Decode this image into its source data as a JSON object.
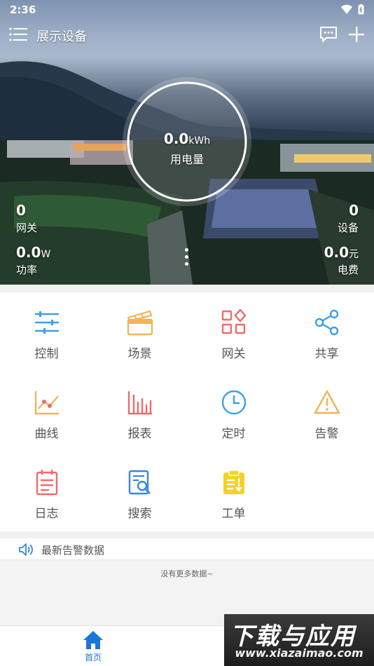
{
  "status_bar": {
    "time": "2:36"
  },
  "header": {
    "title": "展示设备"
  },
  "gauge": {
    "value": "0.0",
    "unit": "kWh",
    "label": "用电量"
  },
  "stats": {
    "gateway": {
      "value": "0",
      "label": "网关"
    },
    "device": {
      "value": "0",
      "label": "设备"
    },
    "power": {
      "value": "0.0",
      "unit": "W",
      "label": "功率"
    },
    "cost": {
      "value": "0.0",
      "unit": "元",
      "label": "电费"
    }
  },
  "menu_grid": {
    "items": [
      {
        "label": "控制",
        "icon": "sliders-icon",
        "color": "#3aa0e8"
      },
      {
        "label": "场景",
        "icon": "clapperboard-icon",
        "color": "#f0b45a"
      },
      {
        "label": "网关",
        "icon": "gateway-grid-icon",
        "color": "#ef6b6b"
      },
      {
        "label": "共享",
        "icon": "share-icon",
        "color": "#3aa0e8"
      },
      {
        "label": "曲线",
        "icon": "line-chart-icon",
        "color": "#f0b45a"
      },
      {
        "label": "报表",
        "icon": "bar-chart-icon",
        "color": "#ef6b6b"
      },
      {
        "label": "定时",
        "icon": "clock-icon",
        "color": "#3aa0e8"
      },
      {
        "label": "告警",
        "icon": "warning-icon",
        "color": "#f0b45a"
      },
      {
        "label": "日志",
        "icon": "calendar-log-icon",
        "color": "#ef6b6b"
      },
      {
        "label": "搜索",
        "icon": "document-search-icon",
        "color": "#3a86d8"
      },
      {
        "label": "工单",
        "icon": "work-order-icon",
        "color": "#f2d325"
      }
    ]
  },
  "alarms": {
    "title": "最新告警数据",
    "empty_text": "没有更多数据~"
  },
  "bottom_nav": {
    "home_label": "首页"
  },
  "watermark": {
    "title": "下载与应用",
    "url": "www.xiazaimao.com"
  }
}
